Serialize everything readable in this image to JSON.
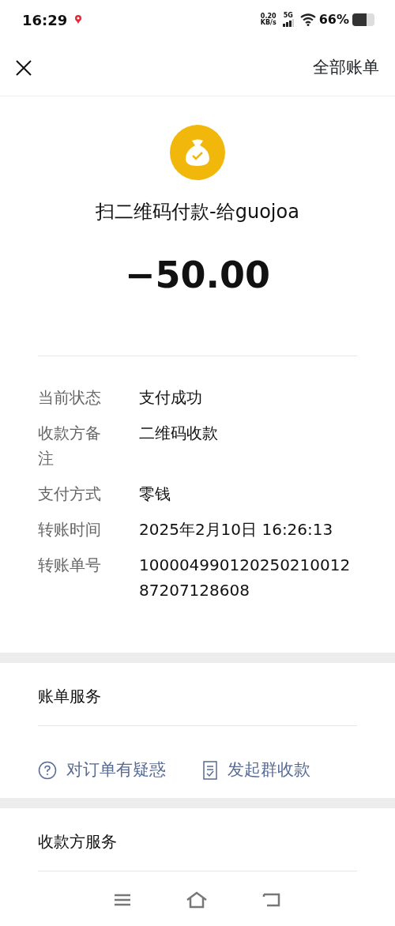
{
  "status_bar": {
    "time": "16:29",
    "net_speed": "0.20",
    "net_unit": "KB/s",
    "network": "5G",
    "battery": "66%"
  },
  "header": {
    "action": "全部账单"
  },
  "summary": {
    "title": "扫二维码付款-给guojoa",
    "amount": "−50.00"
  },
  "details": [
    {
      "label": "当前状态",
      "value": "支付成功"
    },
    {
      "label": "收款方备注",
      "value": "二维码收款"
    },
    {
      "label": "支付方式",
      "value": "零钱"
    },
    {
      "label": "转账时间",
      "value": "2025年2月10日 16:26:13"
    },
    {
      "label": "转账单号",
      "value": "10000499012025021001287207128608"
    }
  ],
  "bill_services": {
    "title": "账单服务",
    "links": [
      {
        "kind": "question",
        "label": "对订单有疑惑"
      },
      {
        "kind": "receipt",
        "label": "发起群收款"
      }
    ]
  },
  "payee_services": {
    "title": "收款方服务"
  }
}
